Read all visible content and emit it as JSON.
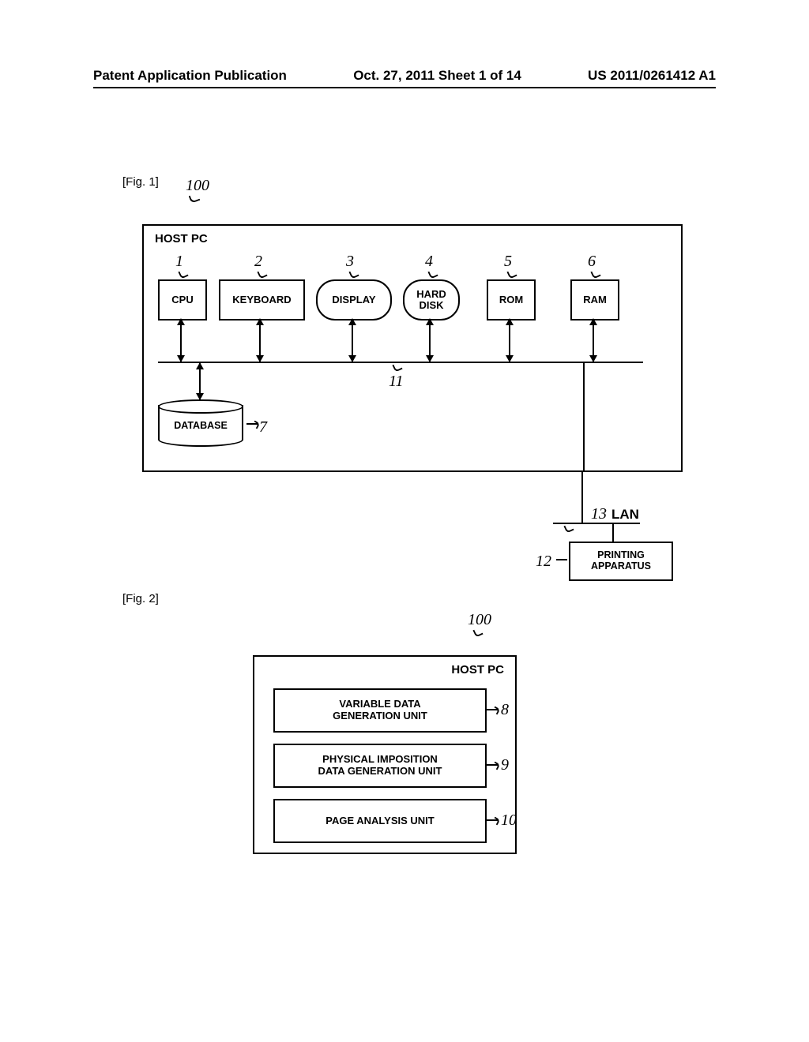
{
  "header": {
    "left": "Patent Application Publication",
    "center": "Oct. 27, 2011  Sheet 1 of 14",
    "right": "US 2011/0261412 A1"
  },
  "fig1": {
    "label": "[Fig. 1]",
    "ref_host": "100",
    "host_label": "HOST PC",
    "refs": {
      "cpu": "1",
      "kbd": "2",
      "disp": "3",
      "hd": "4",
      "rom": "5",
      "ram": "6"
    },
    "components": {
      "cpu": "CPU",
      "kbd": "KEYBOARD",
      "disp": "DISPLAY",
      "hd": "HARD\nDISK",
      "rom": "ROM",
      "ram": "RAM"
    },
    "bus_ref": "11",
    "database": {
      "label": "DATABASE",
      "ref": "7"
    },
    "lan": {
      "ref": "13",
      "label": "LAN"
    },
    "printer": {
      "label": "PRINTING\nAPPARATUS",
      "ref": "12"
    }
  },
  "fig2": {
    "label": "[Fig. 2]",
    "ref_host": "100",
    "host_label": "HOST PC",
    "units": [
      {
        "label": "VARIABLE DATA\nGENERATION UNIT",
        "ref": "8"
      },
      {
        "label": "PHYSICAL IMPOSITION\nDATA GENERATION UNIT",
        "ref": "9"
      },
      {
        "label": "PAGE ANALYSIS UNIT",
        "ref": "10"
      }
    ]
  }
}
